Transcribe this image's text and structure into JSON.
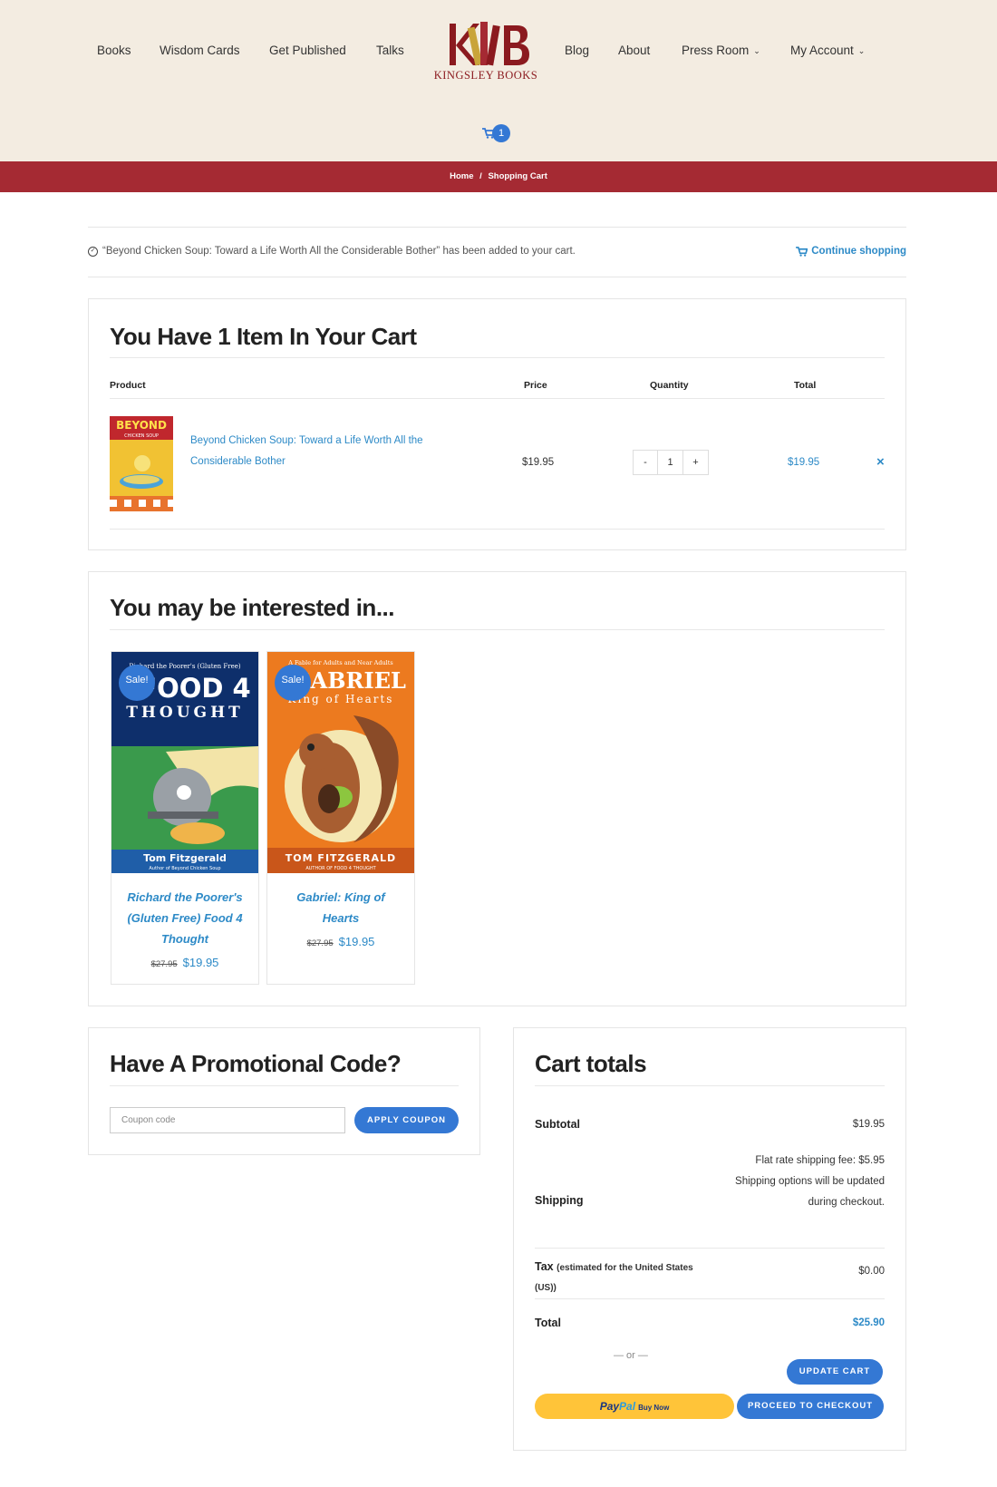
{
  "nav": {
    "left": [
      "Books",
      "Wisdom Cards",
      "Get Published",
      "Talks"
    ],
    "right": [
      "Blog",
      "About",
      "Press Room",
      "My Account"
    ],
    "logo_text": "KINGSLEY BOOKS",
    "cart_count": "1"
  },
  "breadcrumb": {
    "home": "Home",
    "sep": "/",
    "current": "Shopping Cart"
  },
  "notice": {
    "message": "“Beyond Chicken Soup: Toward a Life Worth All the Considerable Bother” has been added to your cart.",
    "continue_label": "Continue shopping"
  },
  "cart": {
    "title": "You Have 1 Item In Your Cart",
    "headers": {
      "product": "Product",
      "price": "Price",
      "quantity": "Quantity",
      "total": "Total"
    },
    "item": {
      "name": "Beyond Chicken Soup: Toward a Life Worth All the Considerable Bother",
      "price": "$19.95",
      "qty": "1",
      "minus": "-",
      "plus": "+",
      "total": "$19.95",
      "remove": "×",
      "cover_title": "BEYOND",
      "cover_sub": "CHICKEN SOUP"
    }
  },
  "related": {
    "title": "You may be interested in...",
    "items": [
      {
        "name": "Richard the Poorer's (Gluten Free) Food 4 Thought",
        "old_price": "$27.95",
        "price": "$19.95",
        "sale": "Sale!",
        "cover_top": "Richard the Poorer's (Gluten Free)",
        "cover_title": "FOOD 4",
        "cover_title2": "THOUGHT",
        "cover_author": "Tom Fitzgerald",
        "cover_author_sub": "Author of Beyond Chicken Soup"
      },
      {
        "name": "Gabriel: King of Hearts",
        "old_price": "$27.95",
        "price": "$19.95",
        "sale": "Sale!",
        "cover_top": "A Fable for Adults and Near Adults",
        "cover_title": "GABRIEL",
        "cover_title2": "King of Hearts",
        "cover_author": "TOM FITZGERALD",
        "cover_author_sub": "AUTHOR OF FOOD 4 THOUGHT"
      }
    ]
  },
  "promo": {
    "title": "Have A Promotional Code?",
    "placeholder": "Coupon code",
    "apply_label": "APPLY COUPON"
  },
  "totals": {
    "title": "Cart totals",
    "subtotal_label": "Subtotal",
    "subtotal": "$19.95",
    "shipping_label": "Shipping",
    "shipping_lines": [
      "Flat rate shipping fee: $5.95",
      "Shipping options will be updated",
      "during checkout."
    ],
    "tax_label": "Tax",
    "tax_note": "(estimated for the United States (US))",
    "tax": "$0.00",
    "total_label": "Total",
    "total": "$25.90",
    "or_text": "— or —",
    "update_label": "UPDATE CART",
    "checkout_label": "PROCEED TO CHECKOUT",
    "paypal_1": "Pay",
    "paypal_2": "Pal",
    "paypal_3": "Buy Now"
  },
  "colors": {
    "header_bg": "#f3ece1",
    "breadcrumb_bg": "#a52a33",
    "accent": "#3478d4",
    "link": "#2d8ac7",
    "paypal": "#ffc439"
  }
}
